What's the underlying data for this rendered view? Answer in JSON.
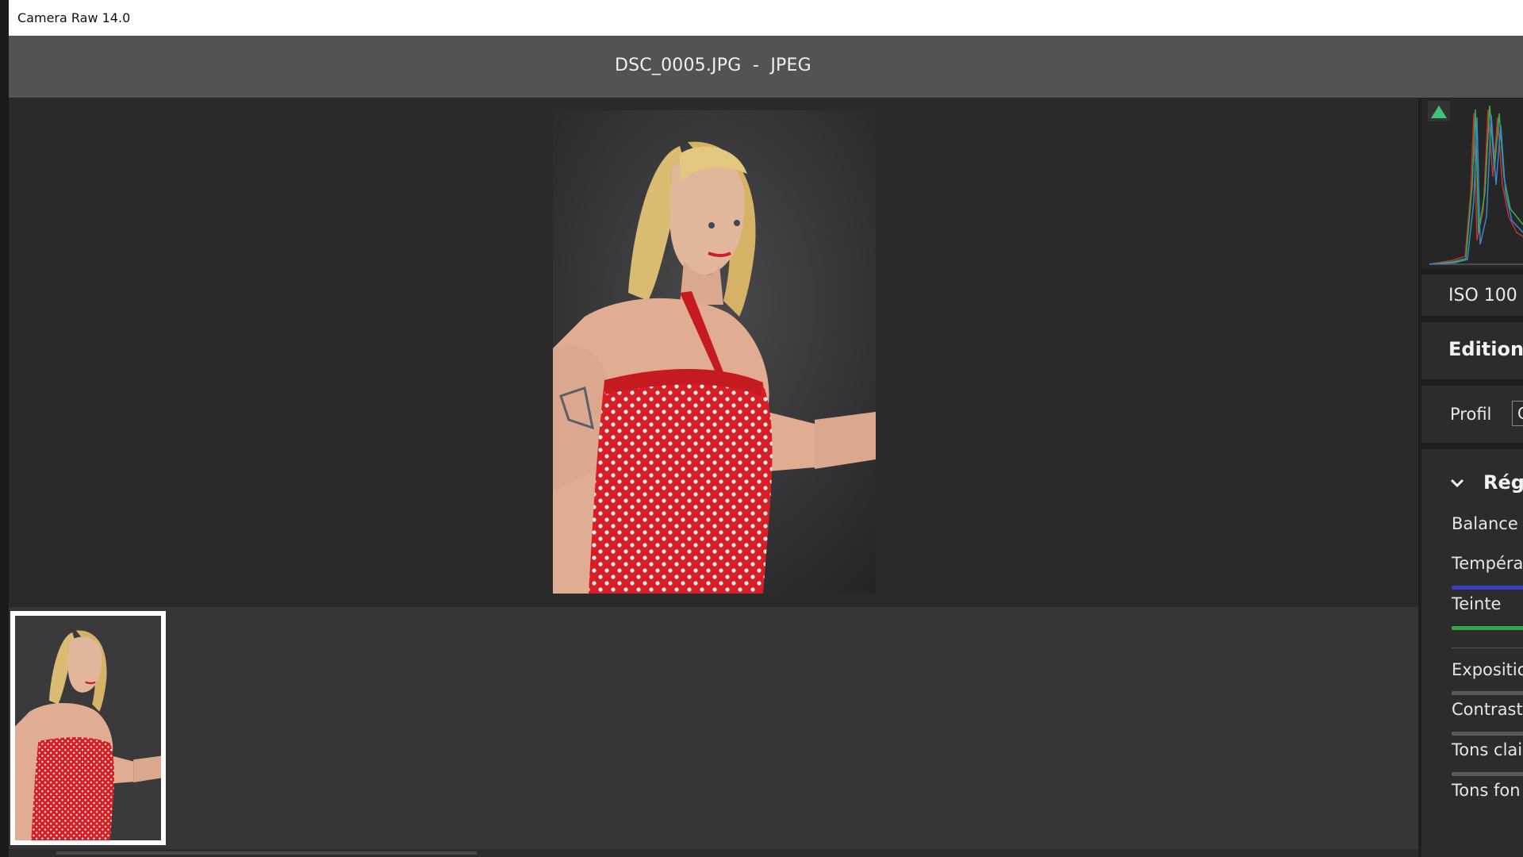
{
  "window": {
    "title": "Camera Raw 14.0"
  },
  "file": {
    "name": "DSC_0005.JPG  -  JPEG"
  },
  "panel": {
    "iso": "ISO 100",
    "edit_label": "Edition",
    "profile_label": "Profil",
    "profile_value": "C",
    "section_title": "Rég",
    "white_balance_label": "Balance d",
    "sliders": [
      {
        "label": "Tempéra"
      },
      {
        "label": "Teinte"
      },
      {
        "label": "Expositio"
      },
      {
        "label": "Contraste"
      },
      {
        "label": "Tons clai"
      },
      {
        "label": "Tons fon"
      }
    ]
  },
  "colors": {
    "clip_indicator": "#3cc47c",
    "temperature_track": "#3a3fc8",
    "tint_track": "#35a845",
    "neutral_track": "#5a5a5a"
  },
  "icons": [
    "clipping-warning-icon",
    "chevron-down-icon"
  ]
}
